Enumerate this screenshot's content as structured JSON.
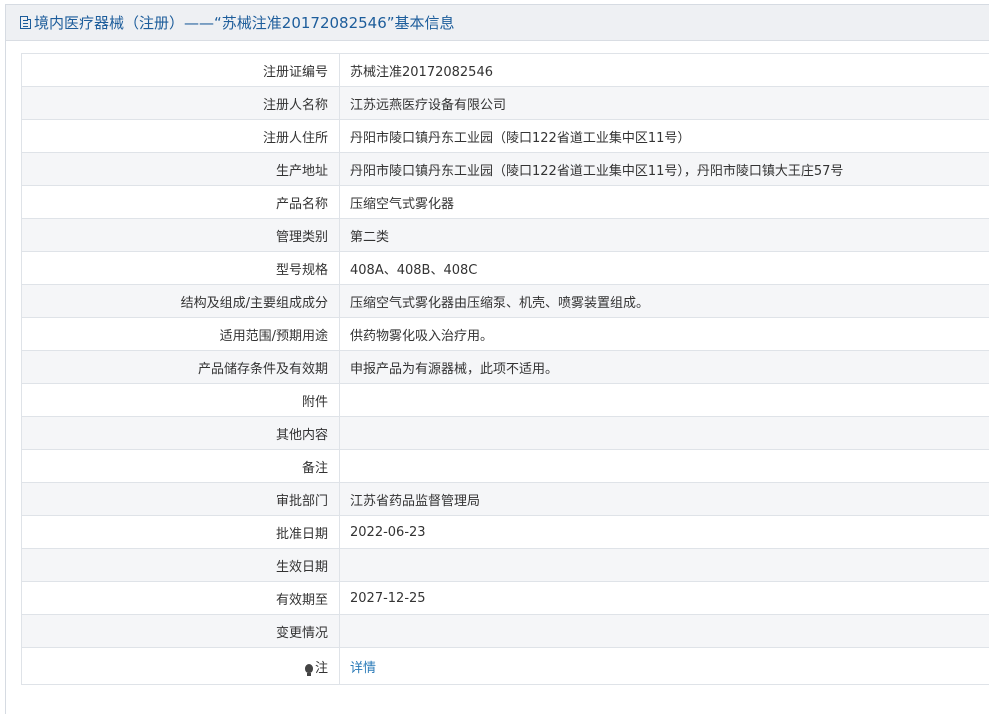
{
  "header": {
    "title": "境内医疗器械（注册）——“苏械注准20172082546”基本信息"
  },
  "rows": [
    {
      "label": "注册证编号",
      "value": "苏械注准20172082546"
    },
    {
      "label": "注册人名称",
      "value": "江苏远燕医疗设备有限公司"
    },
    {
      "label": "注册人住所",
      "value": "丹阳市陵口镇丹东工业园（陵口122省道工业集中区11号）"
    },
    {
      "label": "生产地址",
      "value": "丹阳市陵口镇丹东工业园（陵口122省道工业集中区11号），丹阳市陵口镇大王庄57号"
    },
    {
      "label": "产品名称",
      "value": "压缩空气式雾化器"
    },
    {
      "label": "管理类别",
      "value": "第二类"
    },
    {
      "label": "型号规格",
      "value": "408A、408B、408C"
    },
    {
      "label": "结构及组成/主要组成成分",
      "value": "压缩空气式雾化器由压缩泵、机壳、喷雾装置组成。"
    },
    {
      "label": "适用范围/预期用途",
      "value": "供药物雾化吸入治疗用。"
    },
    {
      "label": "产品储存条件及有效期",
      "value": "申报产品为有源器械，此项不适用。"
    },
    {
      "label": "附件",
      "value": ""
    },
    {
      "label": "其他内容",
      "value": ""
    },
    {
      "label": "备注",
      "value": ""
    },
    {
      "label": "审批部门",
      "value": "江苏省药品监督管理局"
    },
    {
      "label": "批准日期",
      "value": "2022-06-23"
    },
    {
      "label": "生效日期",
      "value": ""
    },
    {
      "label": "有效期至",
      "value": "2027-12-25"
    },
    {
      "label": "变更情况",
      "value": ""
    }
  ],
  "note": {
    "label": "注",
    "link_text": "详情",
    "icon": "lightbulb-icon"
  }
}
